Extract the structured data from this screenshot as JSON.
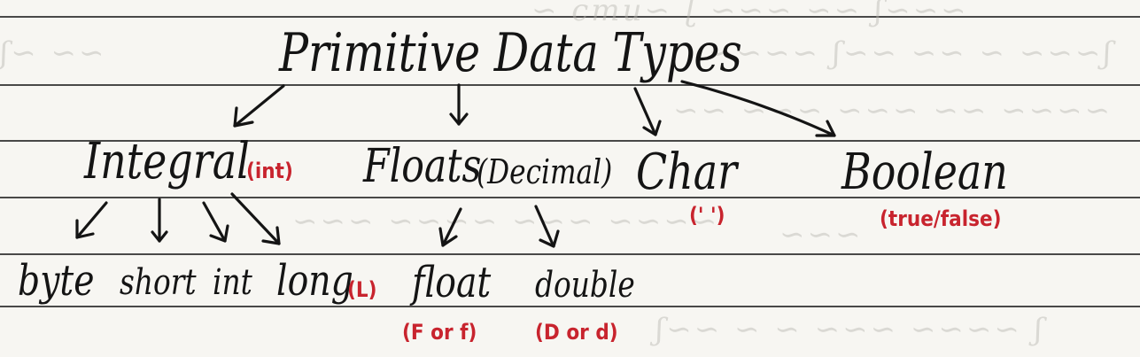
{
  "diagram": {
    "root": {
      "label": "Primitive Data Types"
    },
    "categories": [
      {
        "label": "Integral",
        "note": "(int)",
        "children": [
          {
            "label": "byte"
          },
          {
            "label": "short"
          },
          {
            "label": "int"
          },
          {
            "label": "long",
            "note": "(L)"
          }
        ]
      },
      {
        "label": "Floats",
        "note": "(Decimal)",
        "children": [
          {
            "label": "float",
            "note": "(F or f)"
          },
          {
            "label": "double",
            "note": "(D or d)"
          }
        ]
      },
      {
        "label": "Char",
        "note": "(' ')"
      },
      {
        "label": "Boolean",
        "note": "(true/false)"
      }
    ]
  },
  "colors": {
    "ink": "#141414",
    "annotation": "#c8242e",
    "paper": "#f7f6f2",
    "rule": "#2a2a2a",
    "bleed_through": "#b9b6b0"
  }
}
